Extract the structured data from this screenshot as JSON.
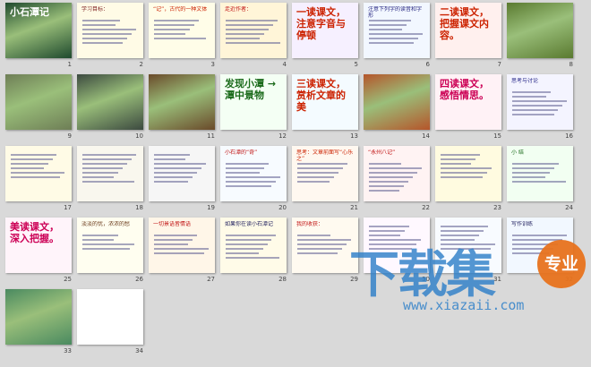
{
  "colors": {
    "window_bg": "#d9d9d9",
    "selection": "#3a6fd8",
    "watermark": "#2f80c9",
    "badge": "#e8731e"
  },
  "slides": [
    {
      "n": "1",
      "kind": "photo",
      "bg": "#1f4a2e",
      "title": "小石潭记",
      "tcolor": "#ffffff"
    },
    {
      "n": "2",
      "kind": "text",
      "bg": "#fffbe6",
      "title": "学习目标：",
      "tcolor": "#7a1a1a",
      "lines": 6
    },
    {
      "n": "3",
      "kind": "text",
      "bg": "#fffde8",
      "title": "“记”，古代的一种文体",
      "tcolor": "#cc2200",
      "lines": 5
    },
    {
      "n": "4",
      "kind": "text",
      "bg": "#fff5d8",
      "title": "走近作者：",
      "tcolor": "#c01010",
      "lines": 6
    },
    {
      "n": "5",
      "kind": "text",
      "bg": "#f6f0ff",
      "title": "一读课文，注意字音与停顿",
      "tcolor": "#cc2200",
      "lines": 0
    },
    {
      "n": "6",
      "kind": "text",
      "bg": "#f2f7ff",
      "title": "注意下列字的读音和字形",
      "tcolor": "#1a1a7a",
      "lines": 6
    },
    {
      "n": "7",
      "kind": "text",
      "bg": "#fff0ee",
      "title": "二读课文，把握课文内容。",
      "tcolor": "#cc2200",
      "lines": 0
    },
    {
      "n": "8",
      "kind": "photo",
      "bg": "#5a7a30",
      "title": "",
      "tcolor": "#ffffff"
    },
    {
      "n": "9",
      "kind": "photo",
      "bg": "#6e7e56",
      "title": "",
      "tcolor": "#ffffff"
    },
    {
      "n": "10",
      "kind": "photo",
      "bg": "#3c4a40",
      "title": "",
      "tcolor": "#ffffff"
    },
    {
      "n": "11",
      "kind": "photo",
      "bg": "#6a4a2a",
      "title": "",
      "tcolor": "#ffffff"
    },
    {
      "n": "12",
      "kind": "text",
      "bg": "#f4fff4",
      "title": "发现小潭 → 潭中景物",
      "tcolor": "#1a6a1a",
      "lines": 0
    },
    {
      "n": "13",
      "kind": "text",
      "bg": "#f4fbff",
      "title": "三读课文，赏析文章的美",
      "tcolor": "#cc2200",
      "lines": 0
    },
    {
      "n": "14",
      "kind": "photo",
      "bg": "#b5552a",
      "title": "",
      "tcolor": "#ffffff"
    },
    {
      "n": "15",
      "kind": "text",
      "bg": "#fff2f6",
      "title": "四读课文，感悟情思。",
      "tcolor": "#cc0055",
      "lines": 0
    },
    {
      "n": "16",
      "kind": "text",
      "bg": "#f4f4ff",
      "title": "思考与讨论",
      "tcolor": "#2a2a8a",
      "lines": 6
    },
    {
      "n": "17",
      "kind": "text",
      "bg": "#fffbe6",
      "title": "",
      "tcolor": "#7a1a1a",
      "lines": 6
    },
    {
      "n": "18",
      "kind": "text",
      "bg": "#f9f7ee",
      "title": "",
      "tcolor": "#2a2a2a",
      "lines": 7
    },
    {
      "n": "19",
      "kind": "text",
      "bg": "#f6f6f6",
      "title": "",
      "tcolor": "#2a2a2a",
      "lines": 7
    },
    {
      "n": "20",
      "kind": "text",
      "bg": "#f7fbff",
      "title": "小石潭的“奇”",
      "tcolor": "#c01010",
      "lines": 6
    },
    {
      "n": "21",
      "kind": "text",
      "bg": "#fff8f0",
      "title": "思考：文章前面写“心乐之”",
      "tcolor": "#cc2200",
      "lines": 5
    },
    {
      "n": "22",
      "kind": "text",
      "bg": "#fff3f3",
      "title": "“永州八记”",
      "tcolor": "#c01010",
      "lines": 7
    },
    {
      "n": "23",
      "kind": "text",
      "bg": "#fffbe0",
      "title": "",
      "tcolor": "#7a1a1a",
      "lines": 6
    },
    {
      "n": "24",
      "kind": "text",
      "bg": "#f2fff2",
      "title": "小 结",
      "tcolor": "#1a6a1a",
      "lines": 5
    },
    {
      "n": "25",
      "kind": "text",
      "bg": "#fff4fa",
      "title": "美读课文，深入把握。",
      "tcolor": "#cc0055",
      "lines": 0
    },
    {
      "n": "26",
      "kind": "text",
      "bg": "#fffef0",
      "title": "淡淡的忧，浓浓的愁",
      "tcolor": "#6a3a1a",
      "lines": 4
    },
    {
      "n": "27",
      "kind": "text",
      "bg": "#fff6e8",
      "title": "一切景语皆情语",
      "tcolor": "#c01010",
      "lines": 5
    },
    {
      "n": "28",
      "kind": "text",
      "bg": "#fffbe8",
      "title": "如果你在读小石潭记",
      "tcolor": "#1a1a5a",
      "lines": 6
    },
    {
      "n": "29",
      "kind": "text",
      "bg": "#fffaf0",
      "title": "我的收获：",
      "tcolor": "#c01010",
      "lines": 5
    },
    {
      "n": "30",
      "kind": "text",
      "bg": "#fff8ff",
      "title": "",
      "tcolor": "#7a1a7a",
      "lines": 6
    },
    {
      "n": "31",
      "kind": "text",
      "bg": "#f8fbff",
      "title": "",
      "tcolor": "#2a2a8a",
      "lines": 6
    },
    {
      "n": "32",
      "kind": "text",
      "bg": "#f2f8ff",
      "title": "写作训练",
      "tcolor": "#1a1a5a",
      "lines": 5
    },
    {
      "n": "33",
      "kind": "photo",
      "bg": "#4a8a60",
      "title": "",
      "tcolor": "#ffffff"
    },
    {
      "n": "34",
      "kind": "blank",
      "bg": "#ffffff",
      "title": "",
      "tcolor": "#000000",
      "lines": 0
    }
  ],
  "watermark": {
    "brand": "下载集",
    "badge": "专业",
    "url": "www.xiazaii.com"
  }
}
